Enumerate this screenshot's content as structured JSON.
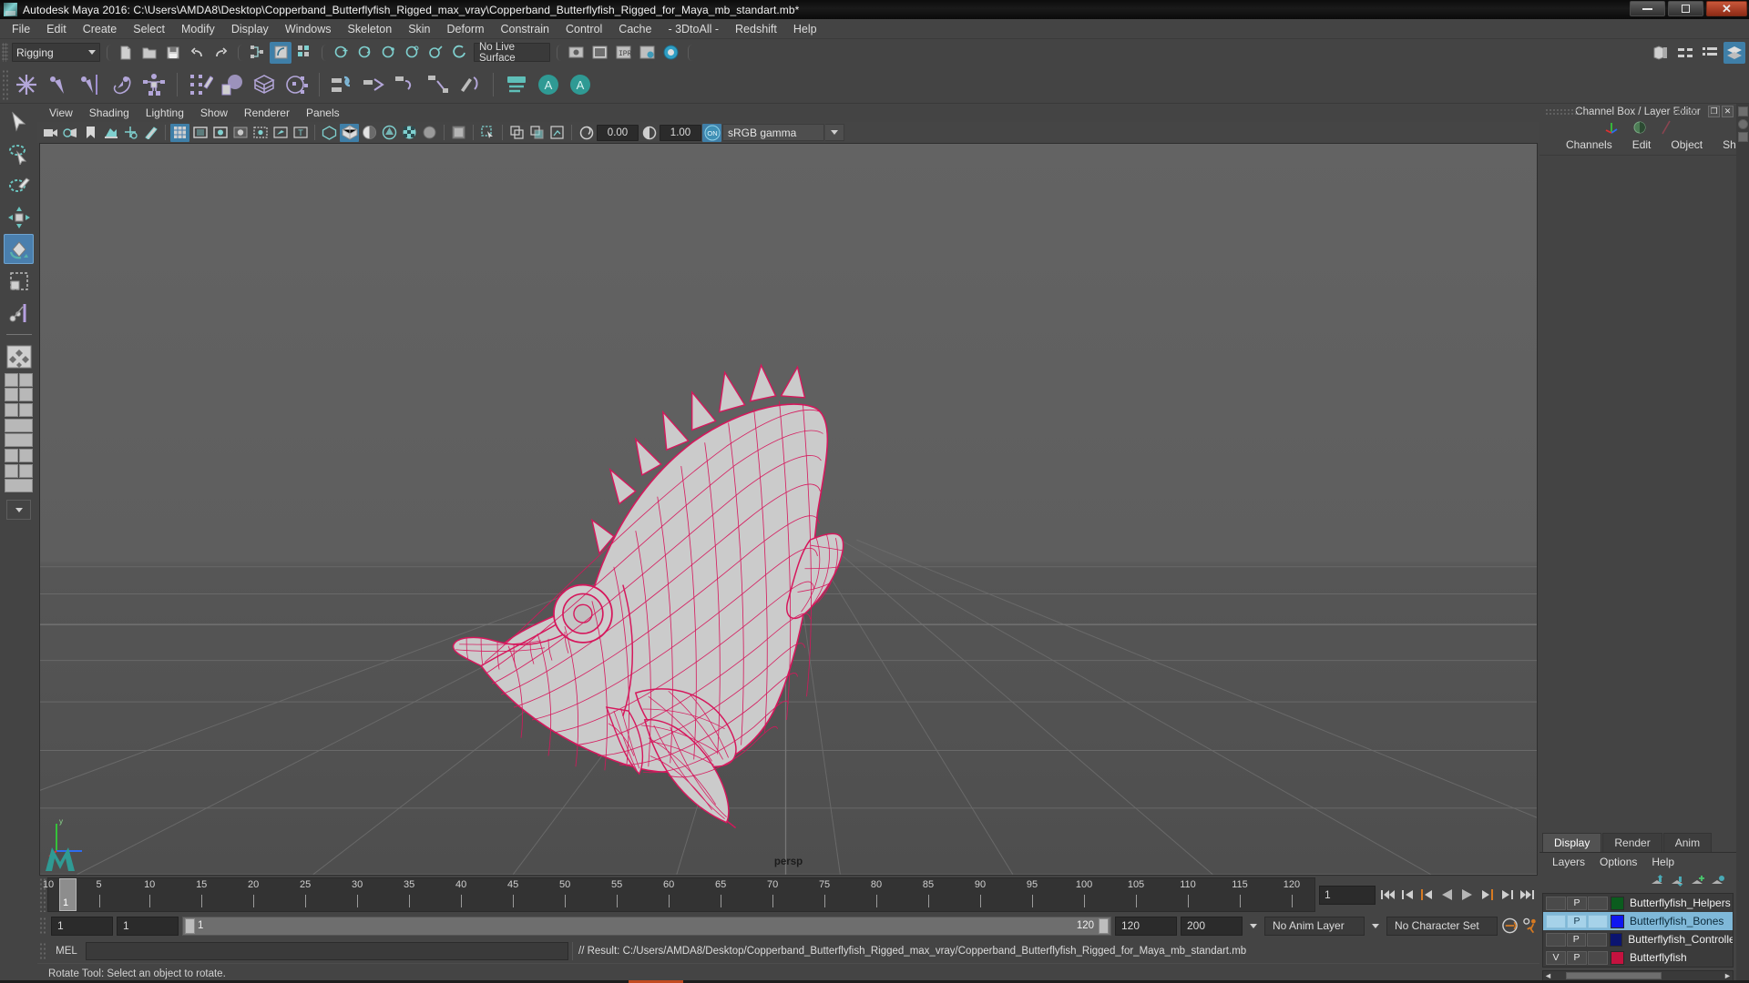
{
  "window": {
    "title": "Autodesk Maya 2016: C:\\Users\\AMDA8\\Desktop\\Copperband_Butterflyfish_Rigged_max_vray\\Copperband_Butterflyfish_Rigged_for_Maya_mb_standart.mb*",
    "app_icon": "maya-icon",
    "minimize": "–",
    "maximize": "❐",
    "close": "✕"
  },
  "menubar": {
    "items": [
      "File",
      "Edit",
      "Create",
      "Select",
      "Modify",
      "Display",
      "Windows",
      "Skeleton",
      "Skin",
      "Deform",
      "Constrain",
      "Control",
      "Cache",
      "- 3DtoAll -",
      "Redshift",
      "Help"
    ]
  },
  "statusbar": {
    "menuset_value": "Rigging",
    "live_surface": "No Live Surface"
  },
  "viewport_panel": {
    "menus": [
      "View",
      "Shading",
      "Lighting",
      "Show",
      "Renderer",
      "Panels"
    ],
    "exposure_value": "0.00",
    "gamma_value": "1.00",
    "color_management": "sRGB gamma",
    "camera_label": "persp"
  },
  "timeslider": {
    "ticks": [
      "5",
      "10",
      "15",
      "20",
      "25",
      "30",
      "35",
      "40",
      "45",
      "50",
      "55",
      "60",
      "65",
      "70",
      "75",
      "80",
      "85",
      "90",
      "95",
      "100",
      "105",
      "110",
      "115",
      "120"
    ],
    "current_frame": "1",
    "frame_field": "1"
  },
  "rangeslider": {
    "start_field": "1",
    "start_field2": "1",
    "range_start_label": "1",
    "range_end_label": "120",
    "end_field": "120",
    "playback_end_field": "200",
    "anim_layer": "No Anim Layer",
    "character_set": "No Character Set"
  },
  "commandline": {
    "mel_label": "MEL",
    "mel_input": "",
    "result": "// Result: C:/Users/AMDA8/Desktop/Copperband_Butterflyfish_Rigged_max_vray/Copperband_Butterflyfish_Rigged_for_Maya_mb_standart.mb"
  },
  "helpline": {
    "text": "Rotate Tool: Select an object to rotate."
  },
  "rightpanel": {
    "title": "Channel Box / Layer Editor",
    "undock": "❐",
    "close": "✕",
    "tabs": [
      "Channels",
      "Edit",
      "Object",
      "Show"
    ],
    "layer_tabs": [
      "Display",
      "Render",
      "Anim"
    ],
    "layer_tab_active": "Display",
    "layer_menus": [
      "Layers",
      "Options",
      "Help"
    ],
    "layers": [
      {
        "v": "",
        "p": "P",
        "t": "",
        "color": "#0b5c1e",
        "name": "Butterflyfish_Helpers",
        "selected": false
      },
      {
        "v": "",
        "p": "P",
        "t": "",
        "color": "#0f17f0",
        "name": "Butterflyfish_Bones",
        "selected": true
      },
      {
        "v": "",
        "p": "P",
        "t": "",
        "color": "#0b1470",
        "name": "Butterflyfish_Controlle",
        "selected": false
      },
      {
        "v": "V",
        "p": "P",
        "t": "",
        "color": "#c4123f",
        "name": "Butterflyfish",
        "selected": false
      }
    ]
  },
  "colors": {
    "accent_blue": "#3f7fa8",
    "selection_blue": "#7fb8d8",
    "chrome_bg": "#444444",
    "viewport_bg": "#5c5c5c",
    "mesh_wire": "#d6175c",
    "mesh_fill": "#c9c9c9",
    "orange_marker": "#d77a21"
  }
}
